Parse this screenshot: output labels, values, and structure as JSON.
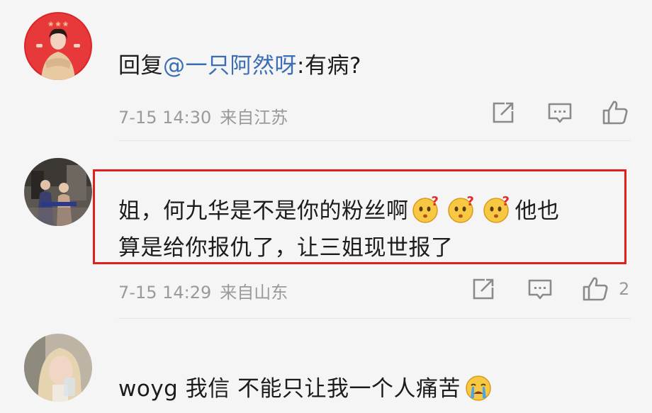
{
  "comments": [
    {
      "prefix": "回复",
      "mention": "@一只阿然呀",
      "text": ":有病?",
      "time": "7-15 14:30",
      "location": "来自江苏",
      "likes": ""
    },
    {
      "line1": "姐，何九华是不是你的粉丝啊",
      "line1_end": "他也",
      "line2": "算是给你报仇了，让三姐现世报了",
      "time": "7-15 14:29",
      "location": "来自山东",
      "likes": "2"
    },
    {
      "text": "woyg 我信 不能只让我一个人痛苦"
    }
  ],
  "icons": {
    "share": "share-icon",
    "reply": "comment-icon",
    "like": "thumbs-up-icon",
    "emoji_question": "confused-question-emoji",
    "emoji_cry": "crying-emoji"
  },
  "colors": {
    "mention": "#3a6db5",
    "meta": "#9a9a9a",
    "highlight_border": "#e0201f"
  }
}
